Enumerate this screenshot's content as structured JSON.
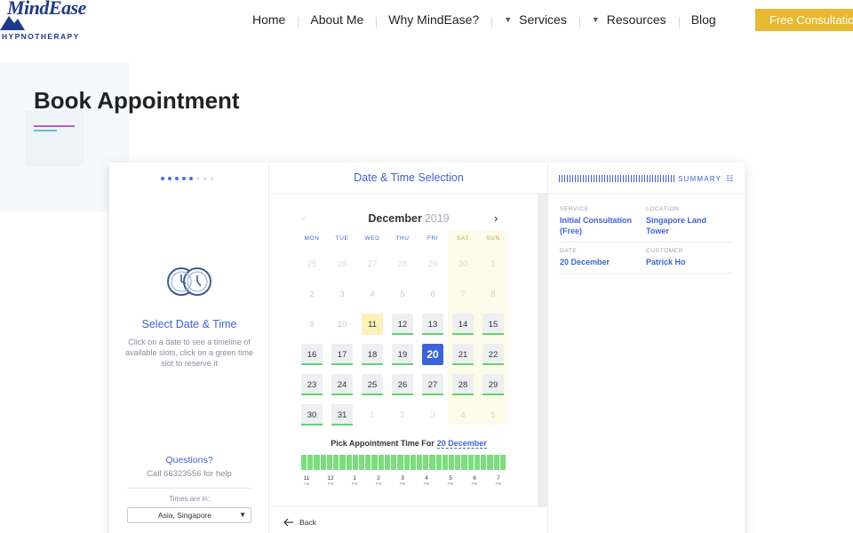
{
  "header": {
    "logo_name": "MindEase",
    "logo_sub": "HYPNOTHERAPY",
    "nav": [
      {
        "label": "Home"
      },
      {
        "label": "About Me"
      },
      {
        "label": "Why MindEase?"
      },
      {
        "label": "Services",
        "dropdown": true
      },
      {
        "label": "Resources",
        "dropdown": true
      },
      {
        "label": "Blog"
      }
    ],
    "cta_label": "Free Consultation"
  },
  "page": {
    "title": "Book Appointment"
  },
  "booking": {
    "step": {
      "title": "Select Date & Time",
      "description": "Click on a date to see a timeline of available slots, click on a green time slot to reserve it",
      "progress": {
        "total": 8,
        "completed": 5
      }
    },
    "help": {
      "title": "Questions?",
      "call": "Call 66323556 for help",
      "timezone_label": "Times are in:",
      "timezone_value": "Asia, Singapore"
    },
    "calendar": {
      "header": "Date & Time Selection",
      "month": "December",
      "year": "2019",
      "weekdays": [
        "MON",
        "TUE",
        "WED",
        "THU",
        "FRI",
        "SAT",
        "SUN"
      ],
      "weeks": [
        [
          "25",
          "26",
          "27",
          "28",
          "29",
          "30",
          "1"
        ],
        [
          "2",
          "3",
          "4",
          "5",
          "6",
          "7",
          "8"
        ],
        [
          "9",
          "10",
          "11",
          "12",
          "13",
          "14",
          "15"
        ],
        [
          "16",
          "17",
          "18",
          "19",
          "20",
          "21",
          "22"
        ],
        [
          "23",
          "24",
          "25",
          "26",
          "27",
          "28",
          "29"
        ],
        [
          "30",
          "31",
          "1",
          "2",
          "3",
          "4",
          "5"
        ]
      ],
      "today": "11",
      "selected": "20",
      "pick_label": "Pick Appointment Time For",
      "pick_date": "20 December",
      "time_ticks": [
        {
          "h": "11",
          "p": "AM"
        },
        {
          "h": "12",
          "p": "PM"
        },
        {
          "h": "1",
          "p": "PM"
        },
        {
          "h": "2",
          "p": "PM"
        },
        {
          "h": "3",
          "p": "PM"
        },
        {
          "h": "4",
          "p": "PM"
        },
        {
          "h": "5",
          "p": "PM"
        },
        {
          "h": "6",
          "p": "PM"
        },
        {
          "h": "7",
          "p": "PM"
        }
      ],
      "back_label": "Back"
    },
    "summary": {
      "title": "SUMMARY",
      "items": [
        {
          "label": "SERVICE",
          "value": "Initial Consultation (Free)"
        },
        {
          "label": "LOCATION",
          "value": "Singapore Land Tower"
        },
        {
          "label": "DATE",
          "value": "20 December"
        },
        {
          "label": "CUSTOMER",
          "value": "Patrick Ho"
        }
      ]
    }
  },
  "colors": {
    "accent": "#3e63d6",
    "cta": "#e7b830",
    "slot_available": "#7bdd7c",
    "weekend": "#fdfbe9"
  }
}
